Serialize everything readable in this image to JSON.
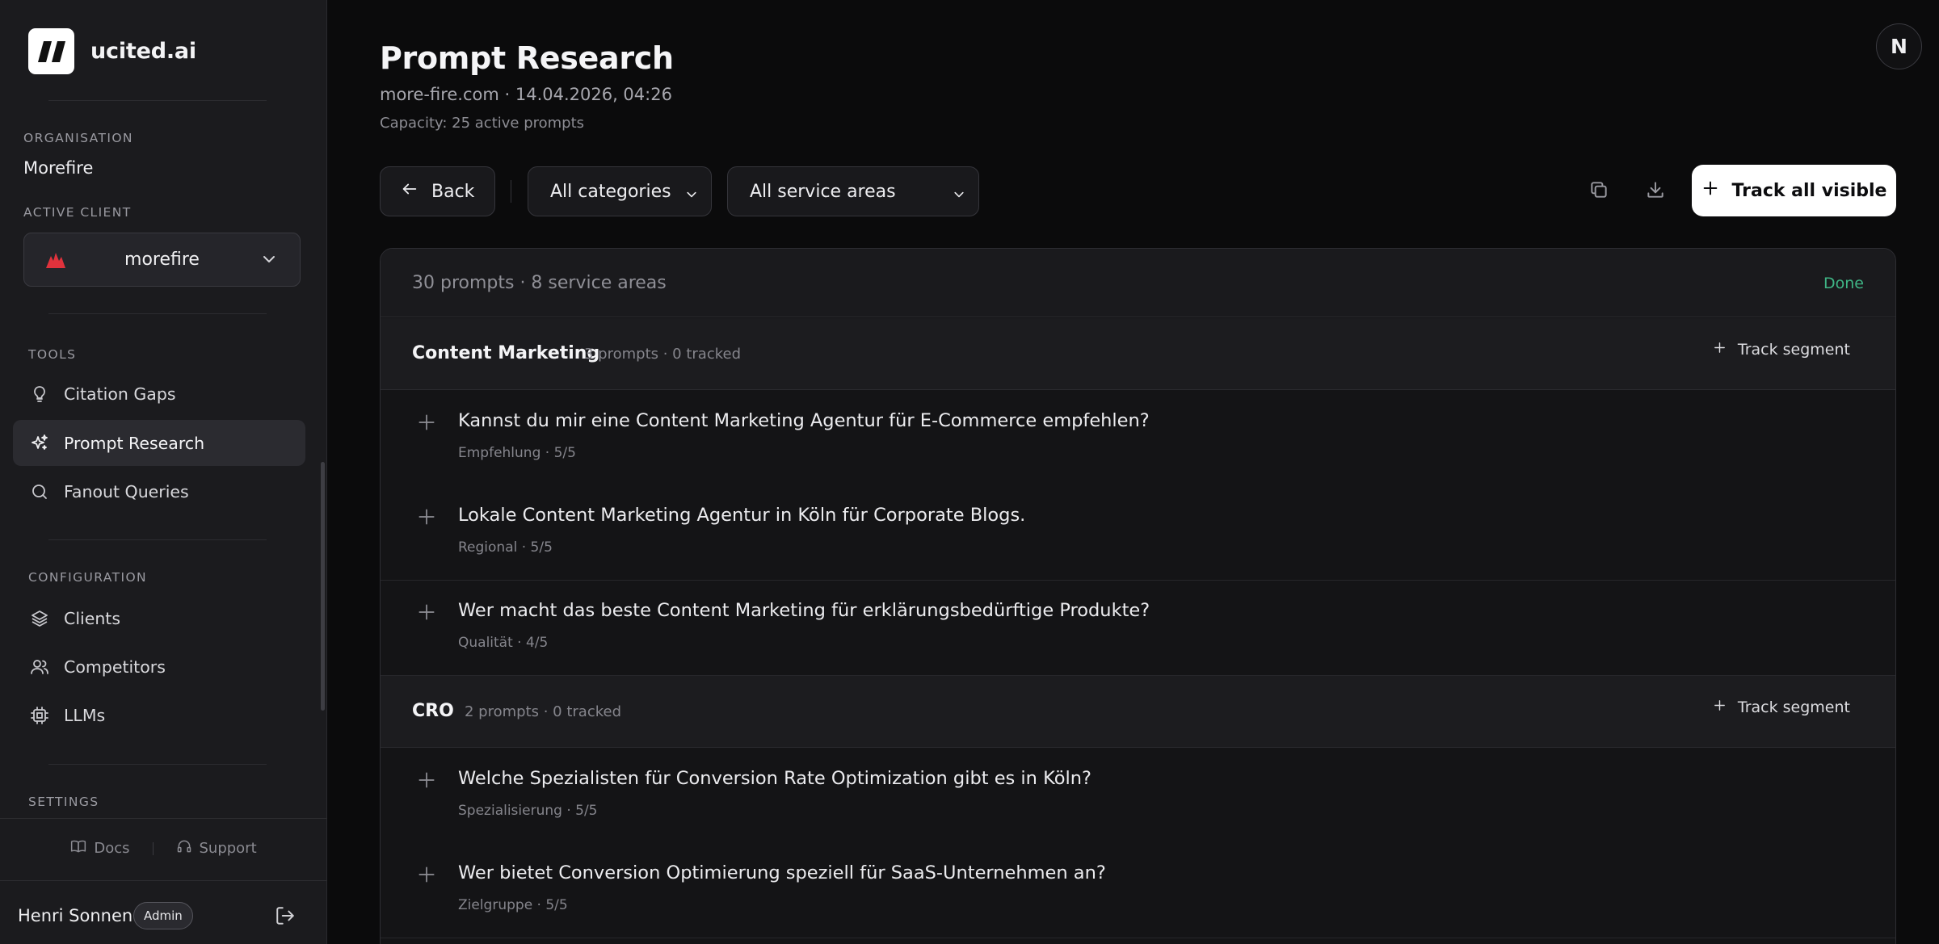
{
  "brand": {
    "name": "ucited.ai"
  },
  "sidebar": {
    "organisation_label": "ORGANISATION",
    "organisation_name": "Morefire",
    "active_client_label": "ACTIVE CLIENT",
    "active_client": "morefire",
    "tools_label": "TOOLS",
    "tools": [
      {
        "label": "Citation Gaps",
        "icon": "lightbulb-icon"
      },
      {
        "label": "Prompt Research",
        "icon": "sparkles-icon",
        "active": true
      },
      {
        "label": "Fanout Queries",
        "icon": "search-icon"
      }
    ],
    "configuration_label": "CONFIGURATION",
    "configuration": [
      {
        "label": "Clients",
        "icon": "layers-icon"
      },
      {
        "label": "Competitors",
        "icon": "users-icon"
      },
      {
        "label": "LLMs",
        "icon": "cpu-icon"
      }
    ],
    "settings_label": "SETTINGS",
    "docs_label": "Docs",
    "support_label": "Support",
    "user_name": "Henri Sonnen",
    "user_role": "Admin"
  },
  "header": {
    "title": "Prompt Research",
    "meta": "more-fire.com · 14.04.2026, 04:26",
    "capacity": "Capacity: 25 active prompts",
    "avatar_letter": "N"
  },
  "toolbar": {
    "back_label": "Back",
    "category_value": "All categories",
    "service_value": "All service areas",
    "track_all_label": "Track all visible"
  },
  "panel": {
    "summary": "30 prompts · 8 service areas",
    "done_label": "Done",
    "segments": [
      {
        "name": "Content Marketing",
        "info": "3 prompts · 0 tracked",
        "track_label": "Track segment",
        "prompts": [
          {
            "text": "Kannst du mir eine Content Marketing Agentur für E-Commerce empfehlen?",
            "meta": "Empfehlung · 5/5"
          },
          {
            "text": "Lokale Content Marketing Agentur in Köln für Corporate Blogs.",
            "meta": "Regional · 5/5"
          },
          {
            "text": "Wer macht das beste Content Marketing für erklärungsbedürftige Produkte?",
            "meta": "Qualität · 4/5"
          }
        ]
      },
      {
        "name": "CRO",
        "info": "2 prompts · 0 tracked",
        "track_label": "Track segment",
        "prompts": [
          {
            "text": "Welche Spezialisten für Conversion Rate Optimization gibt es in Köln?",
            "meta": "Spezialisierung · 5/5"
          },
          {
            "text": "Wer bietet Conversion Optimierung speziell für SaaS-Unternehmen an?",
            "meta": "Zielgruppe · 5/5"
          }
        ]
      }
    ]
  },
  "colors": {
    "accent_done": "#3fb585",
    "client_logo": "#e0323c"
  }
}
